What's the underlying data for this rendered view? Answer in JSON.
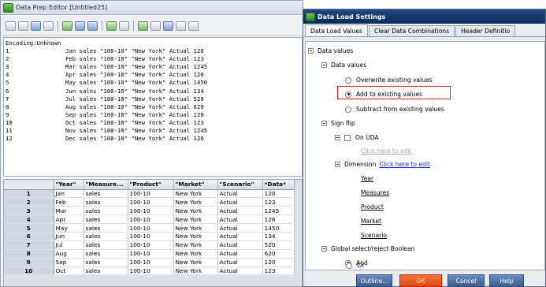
{
  "prep_editor": {
    "title": "Data Prep Editor [Untitled25]",
    "encoding": "Encoding:Unknown",
    "records": [
      {
        "num": "1",
        "text": "Jan sales \"100-10\" \"New York\" Actual 120"
      },
      {
        "num": "2",
        "text": "Feb sales \"100-10\" \"New York\" Actual 123"
      },
      {
        "num": "3",
        "text": "Mar sales \"100-10\" \"New York\" Actual 1245"
      },
      {
        "num": "4",
        "text": "Apr sales \"100-10\" \"New York\" Actual 126"
      },
      {
        "num": "5",
        "text": "May sales \"100-10\" \"New York\" Actual 1450"
      },
      {
        "num": "6",
        "text": "Jun sales \"100-10\" \"New York\" Actual 134"
      },
      {
        "num": "7",
        "text": "Jul sales \"100-10\" \"New York\" Actual 520"
      },
      {
        "num": "8",
        "text": "Aug sales \"100-10\" \"New York\" Actual 620"
      },
      {
        "num": "9",
        "text": "Sep sales \"100-10\" \"New York\" Actual 120"
      },
      {
        "num": "10",
        "text": "Oct sales \"100-10\" \"New York\" Actual 123"
      },
      {
        "num": "11",
        "text": "Nov sales \"100-10\" \"New York\" Actual 1245"
      },
      {
        "num": "12",
        "text": "Dec sales \"100-10\" \"New York\" Actual 126"
      }
    ],
    "grid": {
      "headers": [
        "\"Year\"",
        "\"Measure...",
        "\"Product\"",
        "\"Market\"",
        "\"Scenario\"",
        "*Data*"
      ],
      "rows": [
        {
          "rownum": "1",
          "cells": [
            "Jan",
            "sales",
            "100-10",
            "New York",
            "Actual",
            "120"
          ]
        },
        {
          "rownum": "2",
          "cells": [
            "Feb",
            "sales",
            "100-10",
            "New York",
            "Actual",
            "123"
          ]
        },
        {
          "rownum": "3",
          "cells": [
            "Mar",
            "sales",
            "100-10",
            "New York",
            "Actual",
            "1245"
          ]
        },
        {
          "rownum": "4",
          "cells": [
            "Apr",
            "sales",
            "100-10",
            "New York",
            "Actual",
            "126"
          ]
        },
        {
          "rownum": "5",
          "cells": [
            "May",
            "sales",
            "100-10",
            "New York",
            "Actual",
            "1450"
          ]
        },
        {
          "rownum": "6",
          "cells": [
            "Jun",
            "sales",
            "100-10",
            "New York",
            "Actual",
            "134"
          ]
        },
        {
          "rownum": "7",
          "cells": [
            "Jul",
            "sales",
            "100-10",
            "New York",
            "Actual",
            "520"
          ]
        },
        {
          "rownum": "8",
          "cells": [
            "Aug",
            "sales",
            "100-10",
            "New York",
            "Actual",
            "620"
          ]
        },
        {
          "rownum": "9",
          "cells": [
            "Sep",
            "sales",
            "100-10",
            "New York",
            "Actual",
            "120"
          ]
        },
        {
          "rownum": "10",
          "cells": [
            "Oct",
            "sales",
            "100-10",
            "New York",
            "Actual",
            "123"
          ]
        }
      ]
    }
  },
  "dialog": {
    "title": "Data Load Settings",
    "tabs": [
      "Data Load Values",
      "Clear Data Combinations",
      "Header Definitio"
    ],
    "active_tab": "Data Load Values",
    "tree": {
      "root": "Data values",
      "data_values_group": "Data values",
      "radio_overwrite": "Overwrite existing values",
      "radio_add": "Add to existing values",
      "radio_subtract": "Subtract from existing values",
      "sign_flip": "Sign flip",
      "on_uda": "On UDA",
      "uda_link": "Click here to edit",
      "dimension": "Dimension",
      "dimension_link": "Click here to edit",
      "dimensions": [
        "Year",
        "Measures",
        "Product",
        "Market",
        "Scenario"
      ],
      "global_select": "Global select/reject Boolean",
      "radio_and": "And",
      "radio_or": "Or"
    },
    "selected_value_option": "Add to existing values",
    "selected_boolean": "And",
    "buttons": {
      "outline": "Outline...",
      "ok": "OK",
      "cancel": "Cancel",
      "help": "Help"
    }
  },
  "colors": {
    "dialog_title_bar": "#0a2a57",
    "button_blue": "#3c5f95",
    "ok_orange": "#e04a12",
    "highlight_red": "#e0211b",
    "link_blue": "#1a30c9"
  }
}
